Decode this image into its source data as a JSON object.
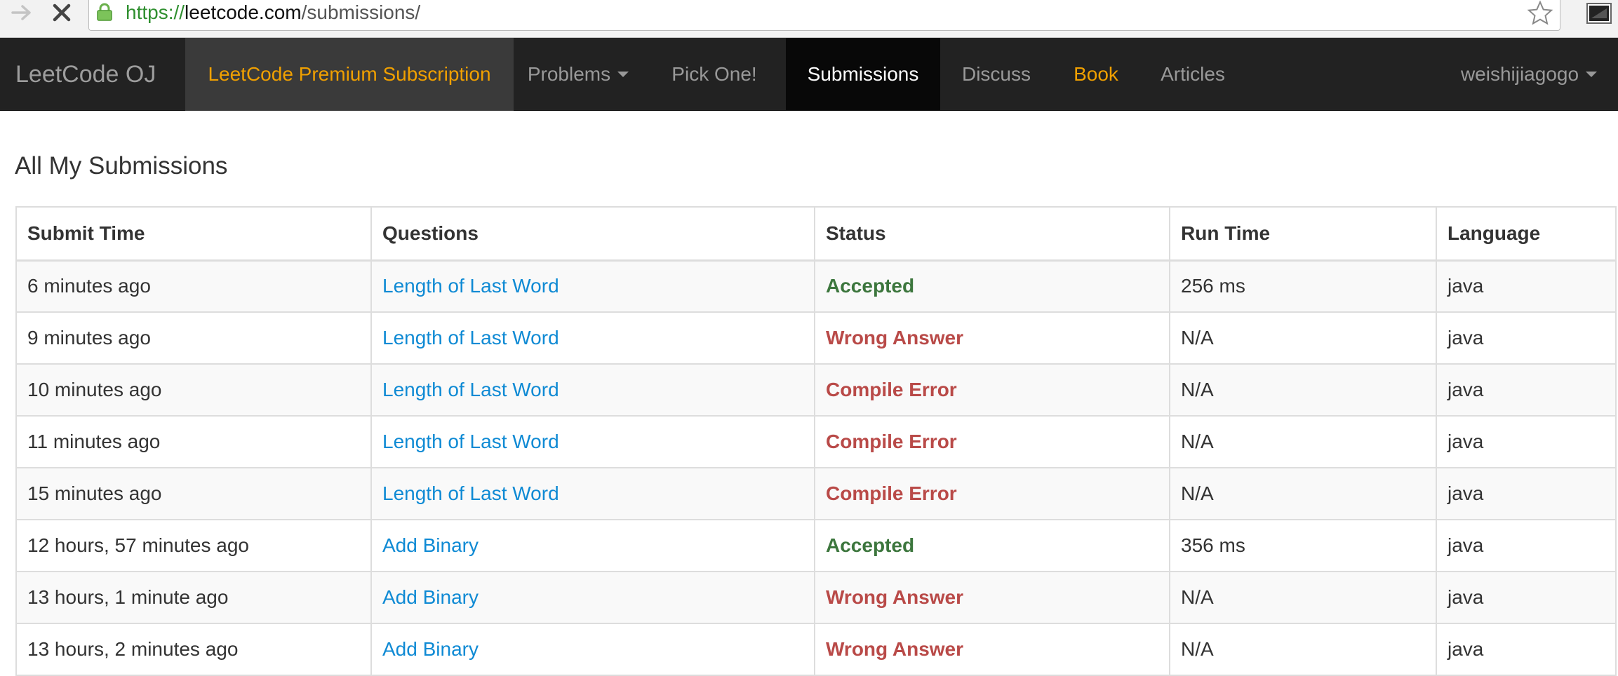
{
  "browser": {
    "url_scheme": "https://",
    "url_host": "leetcode.com",
    "url_path": "/submissions/",
    "icons": {
      "forward": "forward-arrow-icon",
      "stop": "stop-icon",
      "secure": "lock-icon",
      "bookmark": "star-icon",
      "extension": "terminal-icon"
    }
  },
  "navbar": {
    "brand": "LeetCode OJ",
    "premium": "LeetCode Premium Subscription",
    "problems": "Problems",
    "pick_one": "Pick One!",
    "submissions": "Submissions",
    "discuss": "Discuss",
    "book": "Book",
    "articles": "Articles",
    "user": "weishijiagogo",
    "active_tab": "Submissions"
  },
  "page": {
    "title": "All My Submissions"
  },
  "table": {
    "headers": {
      "submit_time": "Submit Time",
      "questions": "Questions",
      "status": "Status",
      "run_time": "Run Time",
      "language": "Language"
    },
    "rows": [
      {
        "submit_time": "6 minutes ago",
        "question": "Length of Last Word",
        "status": "Accepted",
        "run_time": "256 ms",
        "language": "java"
      },
      {
        "submit_time": "9 minutes ago",
        "question": "Length of Last Word",
        "status": "Wrong Answer",
        "run_time": "N/A",
        "language": "java"
      },
      {
        "submit_time": "10 minutes ago",
        "question": "Length of Last Word",
        "status": "Compile Error",
        "run_time": "N/A",
        "language": "java"
      },
      {
        "submit_time": "11 minutes ago",
        "question": "Length of Last Word",
        "status": "Compile Error",
        "run_time": "N/A",
        "language": "java"
      },
      {
        "submit_time": "15 minutes ago",
        "question": "Length of Last Word",
        "status": "Compile Error",
        "run_time": "N/A",
        "language": "java"
      },
      {
        "submit_time": "12 hours, 57 minutes ago",
        "question": "Add Binary",
        "status": "Accepted",
        "run_time": "356 ms",
        "language": "java"
      },
      {
        "submit_time": "13 hours, 1 minute ago",
        "question": "Add Binary",
        "status": "Wrong Answer",
        "run_time": "N/A",
        "language": "java"
      },
      {
        "submit_time": "13 hours, 2 minutes ago",
        "question": "Add Binary",
        "status": "Wrong Answer",
        "run_time": "N/A",
        "language": "java"
      }
    ]
  },
  "colors": {
    "navbar_bg": "#222222",
    "nav_text": "#999999",
    "premium_text": "#f0a000",
    "premium_bg": "#3a3a3a",
    "active_tab_bg": "#080808",
    "link": "#0f8ad4",
    "accepted": "#3c763d",
    "error": "#b94a48",
    "row_stripe": "#f9f9f9",
    "border": "#dddddd"
  }
}
